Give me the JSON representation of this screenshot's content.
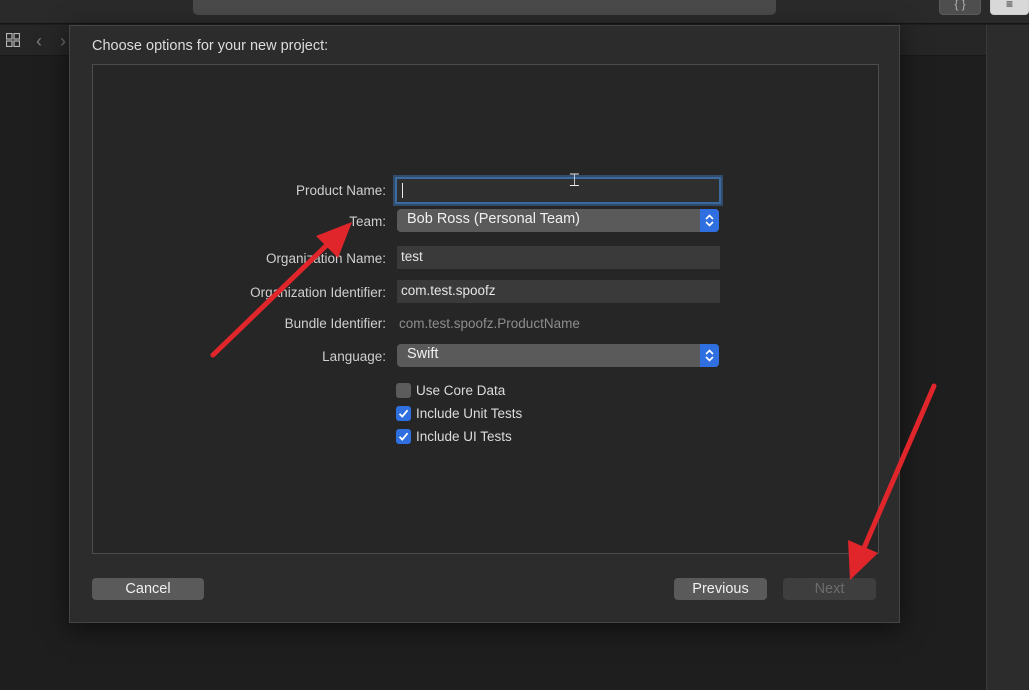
{
  "sheet": {
    "title": "Choose options for your new project:"
  },
  "form": {
    "product_name": {
      "label": "Product Name:",
      "value": ""
    },
    "team": {
      "label": "Team:",
      "value": "Bob Ross (Personal Team)"
    },
    "organization_name": {
      "label": "Organization Name:",
      "value": "test"
    },
    "organization_identifier": {
      "label": "Organization Identifier:",
      "value": "com.test.spoofz"
    },
    "bundle_identifier": {
      "label": "Bundle Identifier:",
      "value": "com.test.spoofz.ProductName"
    },
    "language": {
      "label": "Language:",
      "value": "Swift"
    }
  },
  "options": [
    {
      "label": "Use Core Data",
      "checked": false
    },
    {
      "label": "Include Unit Tests",
      "checked": true
    },
    {
      "label": "Include UI Tests",
      "checked": true
    }
  ],
  "buttons": {
    "cancel": "Cancel",
    "previous": "Previous",
    "next": "Next"
  },
  "icons": {
    "grid": "grid-icon",
    "back": "chevron-left-icon",
    "forward": "chevron-right-icon",
    "ibeam": "text-cursor-icon",
    "popup_stepper": "chevron-up-down-icon",
    "checkmark": "checkmark-icon"
  },
  "colors": {
    "accent": "#2f6fe0",
    "annotation_arrow": "#e0262b"
  }
}
